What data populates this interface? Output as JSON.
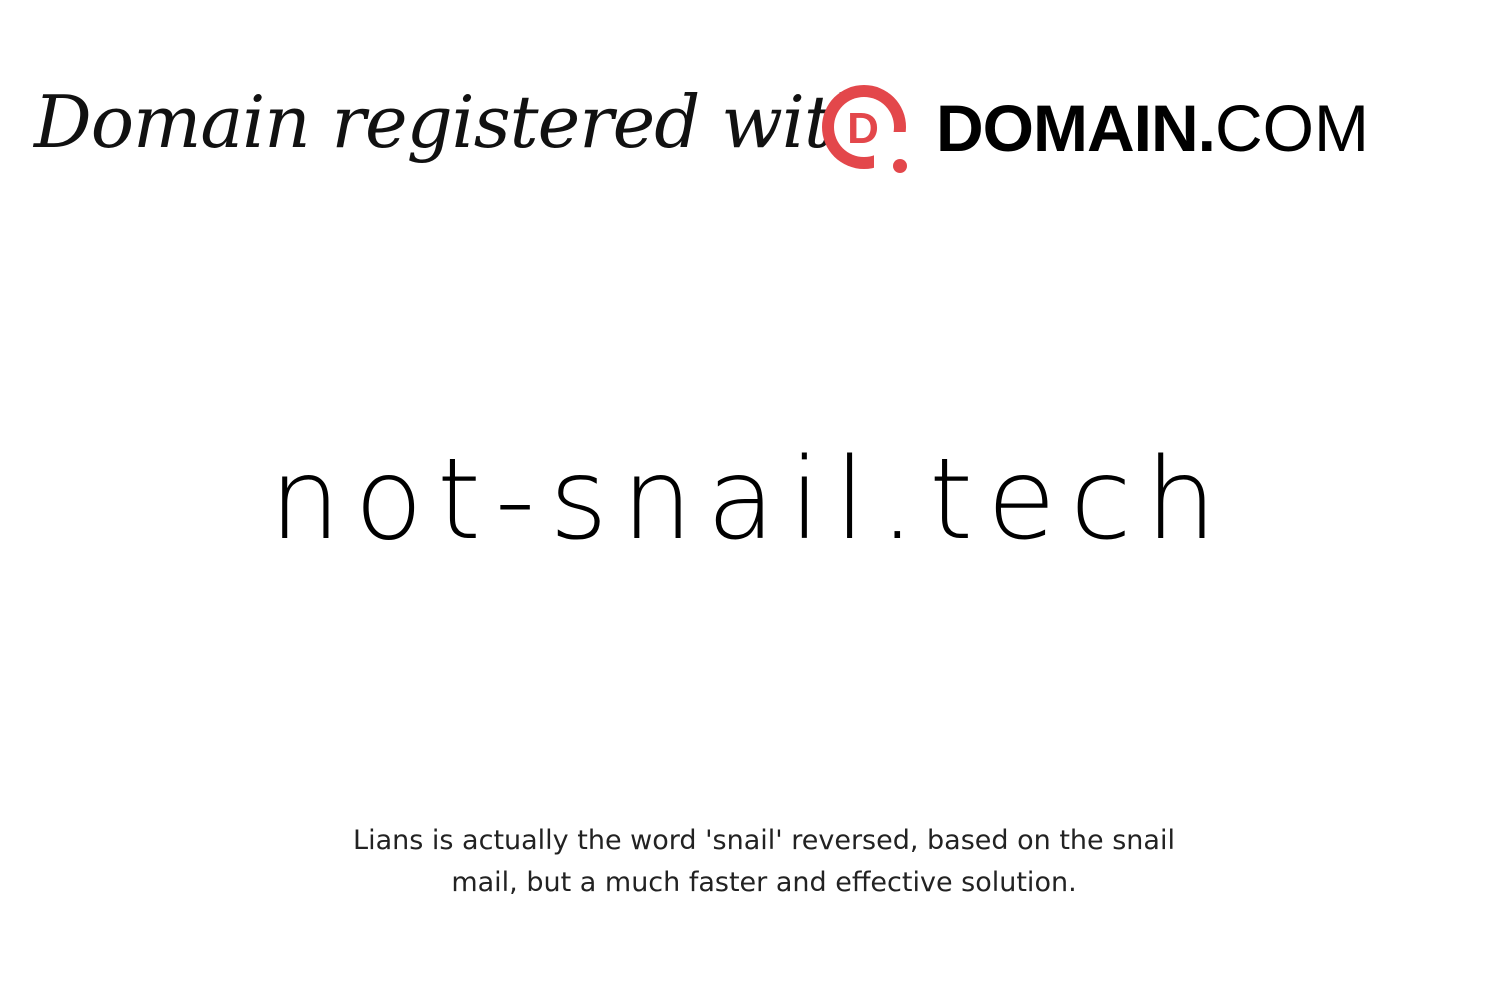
{
  "header": {
    "tagline": "Domain registered with",
    "brand": {
      "logo_icon": "domain-com-d-logo",
      "logo_letter": "D",
      "name_bold": "DOMAIN.",
      "name_light": "COM",
      "accent_color": "#e3474b"
    }
  },
  "main": {
    "domain_name": "not-snail.tech",
    "description": "Lians is actually the word 'snail' reversed, based on the snail mail, but a much faster and effective solution."
  }
}
